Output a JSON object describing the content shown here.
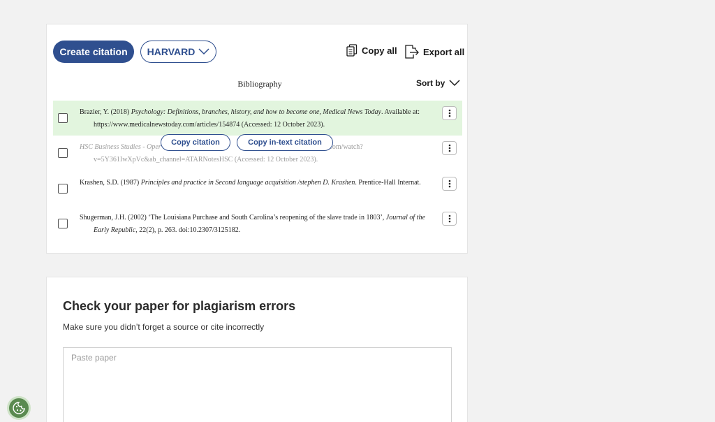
{
  "toolbar": {
    "create_label": "Create citation",
    "style_label": "HARVARD",
    "copy_all_label": "Copy all",
    "export_all_label": "Export all"
  },
  "bibliography": {
    "heading": "Bibliography",
    "sort_label": "Sort by",
    "entries": [
      {
        "pre": "Brazier, Y. (2018) ",
        "italic": "Psychology: Definitions, branches, history, and how to become one, Medical News Today",
        "post": ". Available at: https://www.medicalnewstoday.com/articles/154874 (Accessed: 12 October 2023)."
      },
      {
        "pre": "",
        "italic": "HSC Business Studies - Oper",
        "post": "youtube.com/watch?v=5Y361IwXpVc&ab_channel=ATARNotesHSC (Accessed: 12 October 2023)."
      },
      {
        "pre": "Krashen, S.D. (1987) ",
        "italic": "Principles and practice in Second language acquisition /stephen D. Krashen",
        "post": ". Prentice-Hall Internat."
      },
      {
        "pre": "Shugerman, J.H. (2002) ‘The Louisiana Purchase and South Carolina’s reopening of the slave trade in 1803’, ",
        "italic": "Journal of the Early Republic",
        "post": ", 22(2), p. 263. doi:10.2307/3125182."
      }
    ],
    "hover_actions": {
      "copy_citation": "Copy citation",
      "copy_intext": "Copy in-text citation"
    }
  },
  "plagiarism": {
    "title": "Check your paper for plagiarism errors",
    "subtitle": "Make sure you didn’t forget a source or cite incorrectly",
    "placeholder": "Paste paper"
  },
  "colors": {
    "brand": "#2f4f8f",
    "highlight_row": "#e2f5de",
    "cookie": "#5a8a50"
  },
  "icons": {
    "copy_all": "copy-icon",
    "export_all": "export-icon",
    "style_dropdown": "chevron-down-icon",
    "sort": "chevron-down-icon",
    "row_menu": "more-vertical-icon",
    "cookie": "cookie-icon"
  }
}
